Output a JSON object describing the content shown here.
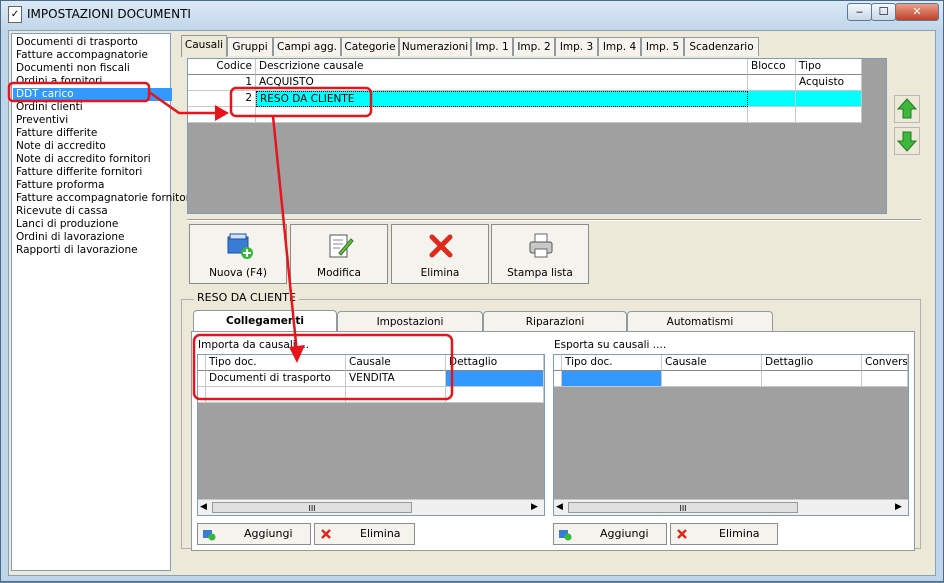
{
  "window": {
    "title": "IMPOSTAZIONI DOCUMENTI",
    "min": "‒",
    "max": "☐",
    "close": "✕"
  },
  "doc_list": [
    "Documenti di trasporto",
    "Fatture accompagnatorie",
    "Documenti non fiscali",
    "Ordini a fornitori",
    "DDT carico",
    "Ordini clienti",
    "Preventivi",
    "Fatture differite",
    "Note di accredito",
    "Note di accredito fornitori",
    "Fatture differite fornitori",
    "Fatture proforma",
    "Fatture accompagnatorie fornitori",
    "Ricevute di cassa",
    "Lanci di produzione",
    "Ordini di lavorazione",
    "Rapporti di lavorazione"
  ],
  "tabs": [
    "Causali",
    "Gruppi",
    "Campi agg.",
    "Categorie",
    "Numerazioni",
    "Imp. 1",
    "Imp. 2",
    "Imp. 3",
    "Imp. 4",
    "Imp. 5",
    "Scadenzario"
  ],
  "causali": {
    "headers": [
      "Codice",
      "Descrizione causale",
      "Blocco",
      "Tipo"
    ],
    "rows": [
      {
        "codice": "1",
        "descrizione": "ACQUISTO",
        "blocco": "",
        "tipo": "Acquisto"
      },
      {
        "codice": "2",
        "descrizione": "RESO DA CLIENTE",
        "blocco": "",
        "tipo": ""
      }
    ]
  },
  "toolbar": {
    "nuova": "Nuova (F4)",
    "modifica": "Modifica",
    "elimina": "Elimina",
    "stampa": "Stampa lista"
  },
  "group_title": "RESO DA CLIENTE",
  "bottom_tabs": [
    "Collegamenti",
    "Impostazioni",
    "Riparazioni",
    "Automatismi"
  ],
  "importa": {
    "label": "Importa da causali ...",
    "headers": [
      "Tipo doc.",
      "Causale",
      "Dettaglio"
    ],
    "rows": [
      {
        "tipo": "Documenti di trasporto",
        "causale": "VENDITA",
        "dettaglio": ""
      }
    ],
    "aggiungi": "Aggiungi",
    "elimina": "Elimina"
  },
  "esporta": {
    "label": "Esporta su causali ....",
    "headers": [
      "Tipo doc.",
      "Causale",
      "Dettaglio",
      "Conversi"
    ],
    "aggiungi": "Aggiungi",
    "elimina": "Elimina"
  },
  "scroll_grip": "III",
  "colors": {
    "selection": "#3399ff",
    "cyan": "#00ffff",
    "annotation": "#e8141c"
  }
}
